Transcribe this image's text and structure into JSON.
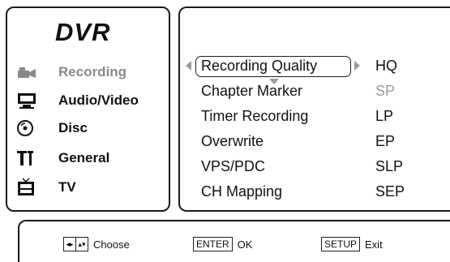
{
  "sidebar": {
    "title": "DVR",
    "items": [
      {
        "label": "Recording",
        "icon": "camcorder-icon",
        "active": true
      },
      {
        "label": "Audio/Video",
        "icon": "monitor-icon"
      },
      {
        "label": "Disc",
        "icon": "disc-icon"
      },
      {
        "label": "General",
        "icon": "tools-icon"
      },
      {
        "label": "TV",
        "icon": "tv-icon"
      }
    ]
  },
  "menu": {
    "options": [
      "Recording Quality",
      "Chapter Marker",
      "Timer Recording",
      "Overwrite",
      "VPS/PDC",
      "CH Mapping"
    ],
    "values": [
      "HQ",
      "SP",
      "LP",
      "EP",
      "SLP",
      "SEP"
    ],
    "selected_option": "Recording Quality",
    "highlighted_value": "SP"
  },
  "footer": {
    "choose_label": "Choose",
    "ok_key": "ENTER",
    "ok_label": "OK",
    "exit_key": "SETUP",
    "exit_label": "Exit"
  },
  "colors": {
    "dim": "#8a8a8a",
    "border": "#1a1a1a"
  }
}
